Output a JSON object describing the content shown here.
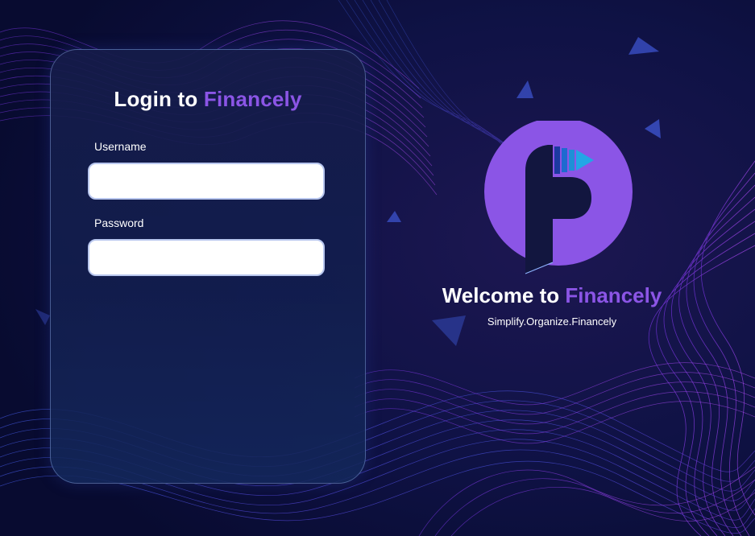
{
  "colors": {
    "background": "#0b0f3a",
    "brand_purple": "#8b55e6",
    "logo_circle": "#8b55e6",
    "logo_letter": "#12163f",
    "accent_blue": "#1e90d6",
    "card_border": "#8caae6",
    "wave_purple": "#9b3cf0",
    "wave_blue": "#3a63e0"
  },
  "login": {
    "title_prefix": "Login to ",
    "title_brand": "Financely",
    "username_label": "Username",
    "username_value": "",
    "password_label": "Password",
    "password_value": ""
  },
  "welcome": {
    "title_prefix": "Welcome to ",
    "title_brand": "Financely",
    "tagline": "Simplify.Organize.Financely"
  },
  "icons": {
    "logo": "financely-f-logo-icon",
    "decor": "triangle-icon"
  }
}
